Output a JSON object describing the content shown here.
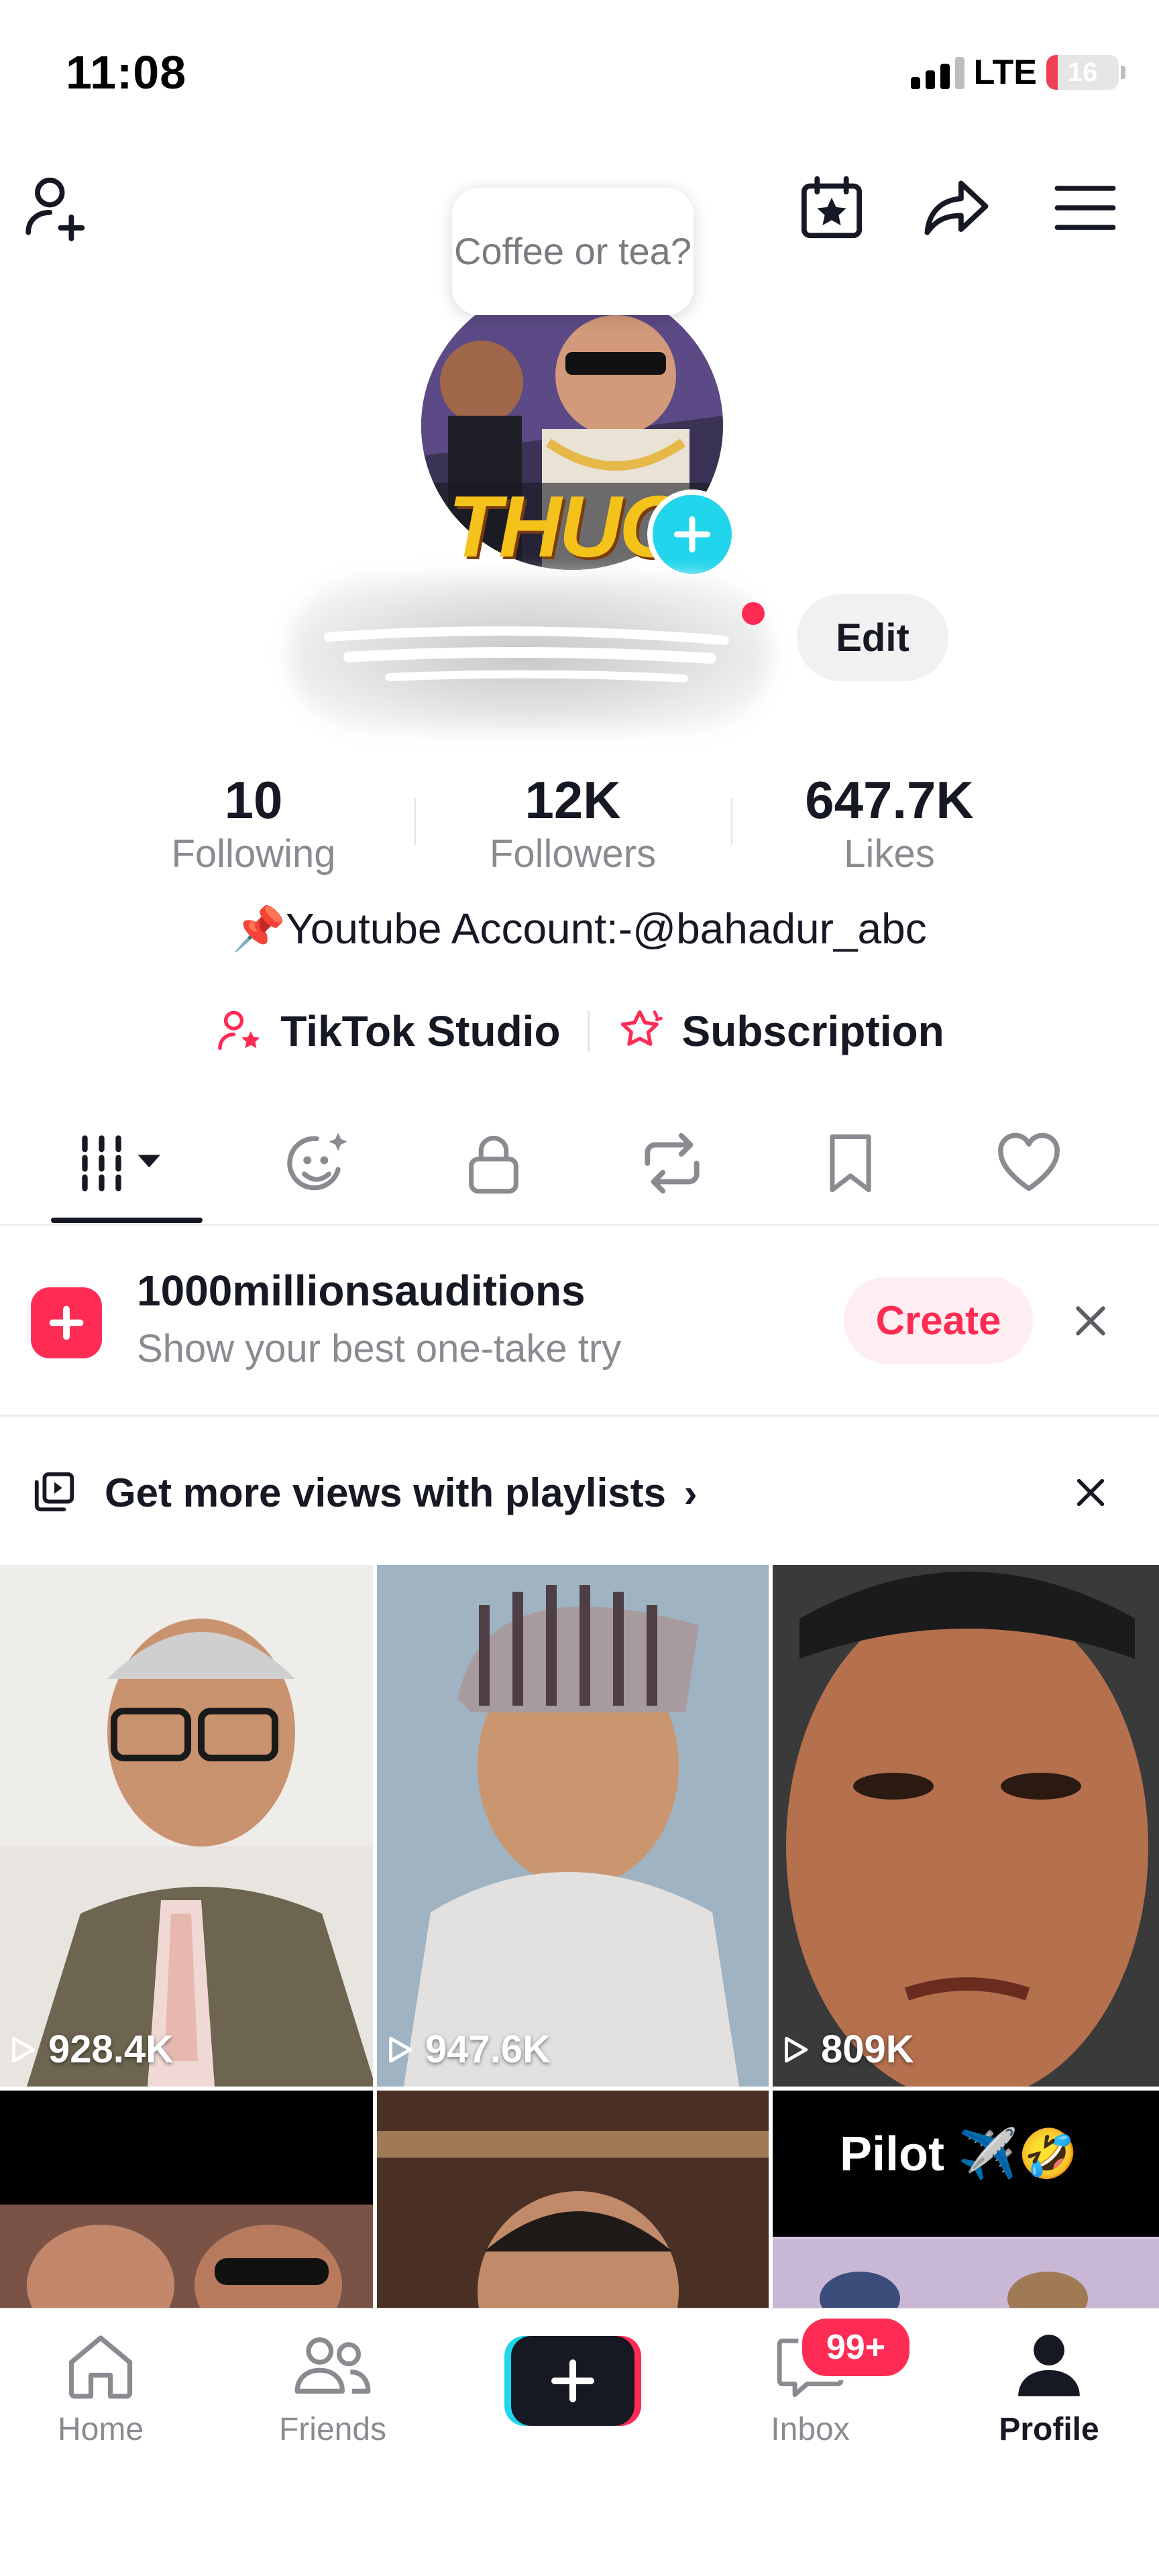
{
  "status_bar": {
    "time": "11:08",
    "network": "LTE",
    "battery": "16",
    "battery_level": 0.16
  },
  "profile": {
    "note_bubble": "Coffee or tea?",
    "avatar_text": "THUG",
    "edit_label": "Edit",
    "stats": [
      {
        "value": "10",
        "label": "Following"
      },
      {
        "value": "12K",
        "label": "Followers"
      },
      {
        "value": "647.7K",
        "label": "Likes"
      }
    ],
    "bio": "📌Youtube Account:-@bahadur_abc",
    "links": {
      "studio": "TikTok Studio",
      "subscription": "Subscription"
    }
  },
  "audition_banner": {
    "title": "1000millionsauditions",
    "subtitle": "Show your best one-take try",
    "create_label": "Create"
  },
  "playlist_prompt": {
    "text": "Get more views with playlists"
  },
  "videos": [
    {
      "views": "928.4K"
    },
    {
      "views": "947.6K"
    },
    {
      "views": "809K"
    },
    {
      "views": ""
    },
    {
      "views": ""
    },
    {
      "views": "",
      "caption": "Pilot ✈️🤣"
    }
  ],
  "nav": {
    "home": "Home",
    "friends": "Friends",
    "inbox": "Inbox",
    "inbox_badge": "99+",
    "profile": "Profile"
  },
  "colors": {
    "accent": "#fe2c55",
    "cyan": "#20d5ec",
    "text": "#161823",
    "secondary": "#8a8b91"
  }
}
